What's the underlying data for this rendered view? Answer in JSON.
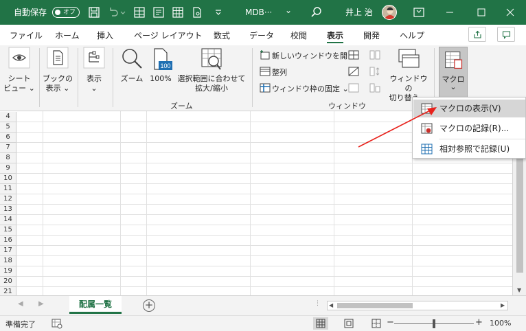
{
  "titlebar": {
    "autosave_label": "自動保存",
    "autosave_state": "オフ",
    "filename": "MDB···",
    "filename_caret": "⌄",
    "user": "井上 治"
  },
  "tabs": [
    "ファイル",
    "ホーム",
    "挿入",
    "ページ レイアウト",
    "数式",
    "データ",
    "校閲",
    "表示",
    "開発",
    "ヘルプ"
  ],
  "active_tab": "表示",
  "ribbon": {
    "sheet_view": [
      "シート",
      "ビュー ⌄"
    ],
    "book_view": [
      "ブックの",
      "表示 ⌄"
    ],
    "show": [
      "表示",
      "⌄"
    ],
    "zoom": "ズーム",
    "zoom100": "100%",
    "zoom100_icon_text": "100",
    "zoom_selection": [
      "選択範囲に合わせて",
      "拡大/縮小"
    ],
    "zoom_group": "ズーム",
    "new_window": "新しいウィンドウを開く",
    "arrange": "整列",
    "freeze": "ウィンドウ枠の固定 ⌄",
    "switch_window": [
      "ウィンドウの",
      "切り替え ⌄"
    ],
    "window_group": "ウィンドウ",
    "macro": [
      "マクロ",
      "⌄"
    ]
  },
  "menu": {
    "items": [
      "マクロの表示(V)",
      "マクロの記録(R)...",
      "相対参照で記録(U)"
    ]
  },
  "rows": [
    "4",
    "5",
    "6",
    "7",
    "8",
    "9",
    "10",
    "11",
    "12",
    "13",
    "14",
    "15",
    "16",
    "17",
    "18",
    "19",
    "20",
    "21"
  ],
  "sheet_tab": "配属一覧",
  "add_sheet": "+",
  "status": {
    "ready": "準備完了",
    "zoom_level": "100%",
    "zoom_minus": "−",
    "zoom_plus": "+",
    "zoom_fraction": 0.5
  },
  "colors": {
    "accent": "#217346",
    "arrow": "#e8221c"
  }
}
